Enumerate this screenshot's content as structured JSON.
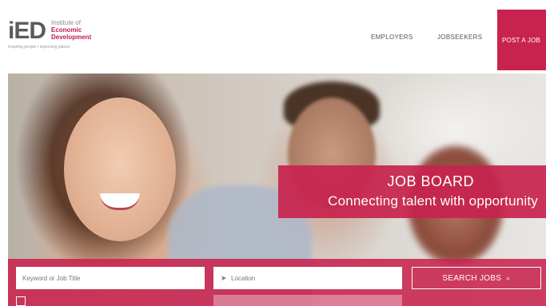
{
  "logo": {
    "mark": "iED",
    "line1": "Institute of",
    "line2": "Economic",
    "line3": "Development",
    "tagline": "Inspiring people • improving places"
  },
  "nav": {
    "employers": "EMPLOYERS",
    "jobseekers": "JOBSEEKERS",
    "post_job": "POST A JOB"
  },
  "banner": {
    "title": "JOB BOARD",
    "subtitle": "Connecting talent with opportunity"
  },
  "search": {
    "keyword_placeholder": "Keyword or Job Title",
    "location_placeholder": "Location",
    "button_label": "SEARCH JOBS"
  },
  "colors": {
    "brand": "#c8234e"
  }
}
